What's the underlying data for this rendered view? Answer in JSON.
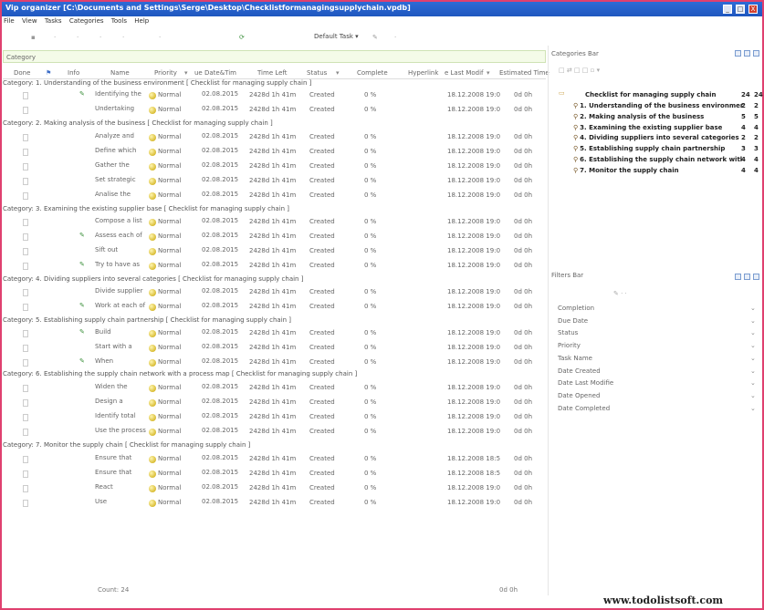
{
  "window": {
    "title": "Vip organizer [C:\\Documents and Settings\\Serge\\Desktop\\Checklistformanagingsupplychain.vpdb]",
    "min_label": "_",
    "max_label": "□",
    "close_label": "X"
  },
  "menu": [
    "File",
    "View",
    "Tasks",
    "Categories",
    "Tools",
    "Help"
  ],
  "toolbar": {
    "view_select": "Default Task ▾"
  },
  "group_by": "Category",
  "columns": [
    "Done",
    "Info",
    "Name",
    "Priority",
    "ue Date&Tim",
    "Time Left",
    "Status",
    "Complete",
    "Hyperlink",
    "e Last Modif",
    "Estimated Time"
  ],
  "categories": [
    {
      "label": "Category: 1. Understanding of the business environment   [ Checklist for managing supply chain ]",
      "tasks": [
        {
          "name": "Identifying the",
          "priority": "Normal",
          "due": "02.08.2015",
          "left": "2428d 1h 41m",
          "status": "Created",
          "complete": "0 %",
          "modified": "18.12.2008 19:0",
          "est": "0d 0h",
          "icon": true
        },
        {
          "name": "Undertaking",
          "priority": "Normal",
          "due": "02.08.2015",
          "left": "2428d 1h 41m",
          "status": "Created",
          "complete": "0 %",
          "modified": "18.12.2008 19:0",
          "est": "0d 0h",
          "icon": false
        }
      ]
    },
    {
      "label": "Category: 2. Making analysis of the business   [ Checklist for managing supply chain ]",
      "tasks": [
        {
          "name": "Analyze and",
          "priority": "Normal",
          "due": "02.08.2015",
          "left": "2428d 1h 41m",
          "status": "Created",
          "complete": "0 %",
          "modified": "18.12.2008 19:0",
          "est": "0d 0h",
          "icon": false
        },
        {
          "name": "Define which",
          "priority": "Normal",
          "due": "02.08.2015",
          "left": "2428d 1h 41m",
          "status": "Created",
          "complete": "0 %",
          "modified": "18.12.2008 19:0",
          "est": "0d 0h",
          "icon": false
        },
        {
          "name": "Gather the",
          "priority": "Normal",
          "due": "02.08.2015",
          "left": "2428d 1h 41m",
          "status": "Created",
          "complete": "0 %",
          "modified": "18.12.2008 19:0",
          "est": "0d 0h",
          "icon": false
        },
        {
          "name": "Set strategic",
          "priority": "Normal",
          "due": "02.08.2015",
          "left": "2428d 1h 41m",
          "status": "Created",
          "complete": "0 %",
          "modified": "18.12.2008 19:0",
          "est": "0d 0h",
          "icon": false
        },
        {
          "name": "Analise the",
          "priority": "Normal",
          "due": "02.08.2015",
          "left": "2428d 1h 41m",
          "status": "Created",
          "complete": "0 %",
          "modified": "18.12.2008 19:0",
          "est": "0d 0h",
          "icon": false
        }
      ]
    },
    {
      "label": "Category: 3. Examining the existing supplier base   [ Checklist for managing supply chain ]",
      "tasks": [
        {
          "name": "Compose a list",
          "priority": "Normal",
          "due": "02.08.2015",
          "left": "2428d 1h 41m",
          "status": "Created",
          "complete": "0 %",
          "modified": "18.12.2008 19:0",
          "est": "0d 0h",
          "icon": false
        },
        {
          "name": "Assess each of",
          "priority": "Normal",
          "due": "02.08.2015",
          "left": "2428d 1h 41m",
          "status": "Created",
          "complete": "0 %",
          "modified": "18.12.2008 19:0",
          "est": "0d 0h",
          "icon": true
        },
        {
          "name": "Sift out",
          "priority": "Normal",
          "due": "02.08.2015",
          "left": "2428d 1h 41m",
          "status": "Created",
          "complete": "0 %",
          "modified": "18.12.2008 19:0",
          "est": "0d 0h",
          "icon": false
        },
        {
          "name": "Try to have as",
          "priority": "Normal",
          "due": "02.08.2015",
          "left": "2428d 1h 41m",
          "status": "Created",
          "complete": "0 %",
          "modified": "18.12.2008 19:0",
          "est": "0d 0h",
          "icon": true
        }
      ]
    },
    {
      "label": "Category: 4. Dividing suppliers into several categories   [ Checklist for managing supply chain ]",
      "tasks": [
        {
          "name": "Divide supplier",
          "priority": "Normal",
          "due": "02.08.2015",
          "left": "2428d 1h 41m",
          "status": "Created",
          "complete": "0 %",
          "modified": "18.12.2008 19:0",
          "est": "0d 0h",
          "icon": false
        },
        {
          "name": "Work at each of",
          "priority": "Normal",
          "due": "02.08.2015",
          "left": "2428d 1h 41m",
          "status": "Created",
          "complete": "0 %",
          "modified": "18.12.2008 19:0",
          "est": "0d 0h",
          "icon": true
        }
      ]
    },
    {
      "label": "Category: 5. Establishing supply chain partnership   [ Checklist for managing supply chain ]",
      "tasks": [
        {
          "name": "Build",
          "priority": "Normal",
          "due": "02.08.2015",
          "left": "2428d 1h 41m",
          "status": "Created",
          "complete": "0 %",
          "modified": "18.12.2008 19:0",
          "est": "0d 0h",
          "icon": true
        },
        {
          "name": "Start with a",
          "priority": "Normal",
          "due": "02.08.2015",
          "left": "2428d 1h 41m",
          "status": "Created",
          "complete": "0 %",
          "modified": "18.12.2008 19:0",
          "est": "0d 0h",
          "icon": false
        },
        {
          "name": "When",
          "priority": "Normal",
          "due": "02.08.2015",
          "left": "2428d 1h 41m",
          "status": "Created",
          "complete": "0 %",
          "modified": "18.12.2008 19:0",
          "est": "0d 0h",
          "icon": true
        }
      ]
    },
    {
      "label": "Category: 6. Establishing the supply chain network with a process map   [ Checklist for managing supply chain ]",
      "tasks": [
        {
          "name": "Widen the",
          "priority": "Normal",
          "due": "02.08.2015",
          "left": "2428d 1h 41m",
          "status": "Created",
          "complete": "0 %",
          "modified": "18.12.2008 19:0",
          "est": "0d 0h",
          "icon": false
        },
        {
          "name": "Design a",
          "priority": "Normal",
          "due": "02.08.2015",
          "left": "2428d 1h 41m",
          "status": "Created",
          "complete": "0 %",
          "modified": "18.12.2008 19:0",
          "est": "0d 0h",
          "icon": false
        },
        {
          "name": "Identify total",
          "priority": "Normal",
          "due": "02.08.2015",
          "left": "2428d 1h 41m",
          "status": "Created",
          "complete": "0 %",
          "modified": "18.12.2008 19:0",
          "est": "0d 0h",
          "icon": false
        },
        {
          "name": "Use the process",
          "priority": "Normal",
          "due": "02.08.2015",
          "left": "2428d 1h 41m",
          "status": "Created",
          "complete": "0 %",
          "modified": "18.12.2008 19:0",
          "est": "0d 0h",
          "icon": false
        }
      ]
    },
    {
      "label": "Category: 7. Monitor the supply chain   [ Checklist for managing supply chain ]",
      "tasks": [
        {
          "name": "Ensure that",
          "priority": "Normal",
          "due": "02.08.2015",
          "left": "2428d 1h 41m",
          "status": "Created",
          "complete": "0 %",
          "modified": "18.12.2008 18:5",
          "est": "0d 0h",
          "icon": false
        },
        {
          "name": "Ensure that",
          "priority": "Normal",
          "due": "02.08.2015",
          "left": "2428d 1h 41m",
          "status": "Created",
          "complete": "0 %",
          "modified": "18.12.2008 18:5",
          "est": "0d 0h",
          "icon": false
        },
        {
          "name": "React",
          "priority": "Normal",
          "due": "02.08.2015",
          "left": "2428d 1h 41m",
          "status": "Created",
          "complete": "0 %",
          "modified": "18.12.2008 19:0",
          "est": "0d 0h",
          "icon": false
        },
        {
          "name": "Use",
          "priority": "Normal",
          "due": "02.08.2015",
          "left": "2428d 1h 41m",
          "status": "Created",
          "complete": "0 %",
          "modified": "18.12.2008 19:0",
          "est": "0d 0h",
          "icon": false
        }
      ]
    }
  ],
  "footer_count": "Count: 24",
  "footer_est": "0d 0h",
  "categories_bar": {
    "title": "Categories Bar",
    "root": {
      "label": "Checklist for managing supply chain",
      "a": "24",
      "b": "24"
    },
    "items": [
      {
        "label": "1. Understanding of the business environmer",
        "a": "2",
        "b": "2"
      },
      {
        "label": "2. Making analysis of the business",
        "a": "5",
        "b": "5"
      },
      {
        "label": "3. Examining the existing supplier base",
        "a": "4",
        "b": "4"
      },
      {
        "label": "4. Dividing suppliers into several categories",
        "a": "2",
        "b": "2"
      },
      {
        "label": "5. Establishing supply chain partnership",
        "a": "3",
        "b": "3"
      },
      {
        "label": "6. Establishing the supply chain network witl",
        "a": "4",
        "b": "4"
      },
      {
        "label": "7. Monitor the supply chain",
        "a": "4",
        "b": "4"
      }
    ]
  },
  "filters_bar": {
    "title": "Filters Bar",
    "items": [
      "Completion",
      "Due Date",
      "Status",
      "Priority",
      "Task Name",
      "Date Created",
      "Date Last Modifie",
      "Date Opened",
      "Date Completed"
    ]
  },
  "watermark": "www.todolistsoft.com",
  "colors": {
    "title_bar": "#1f57bf",
    "frame": "#e0406f",
    "group_row_bg": "#f4fbe8"
  }
}
